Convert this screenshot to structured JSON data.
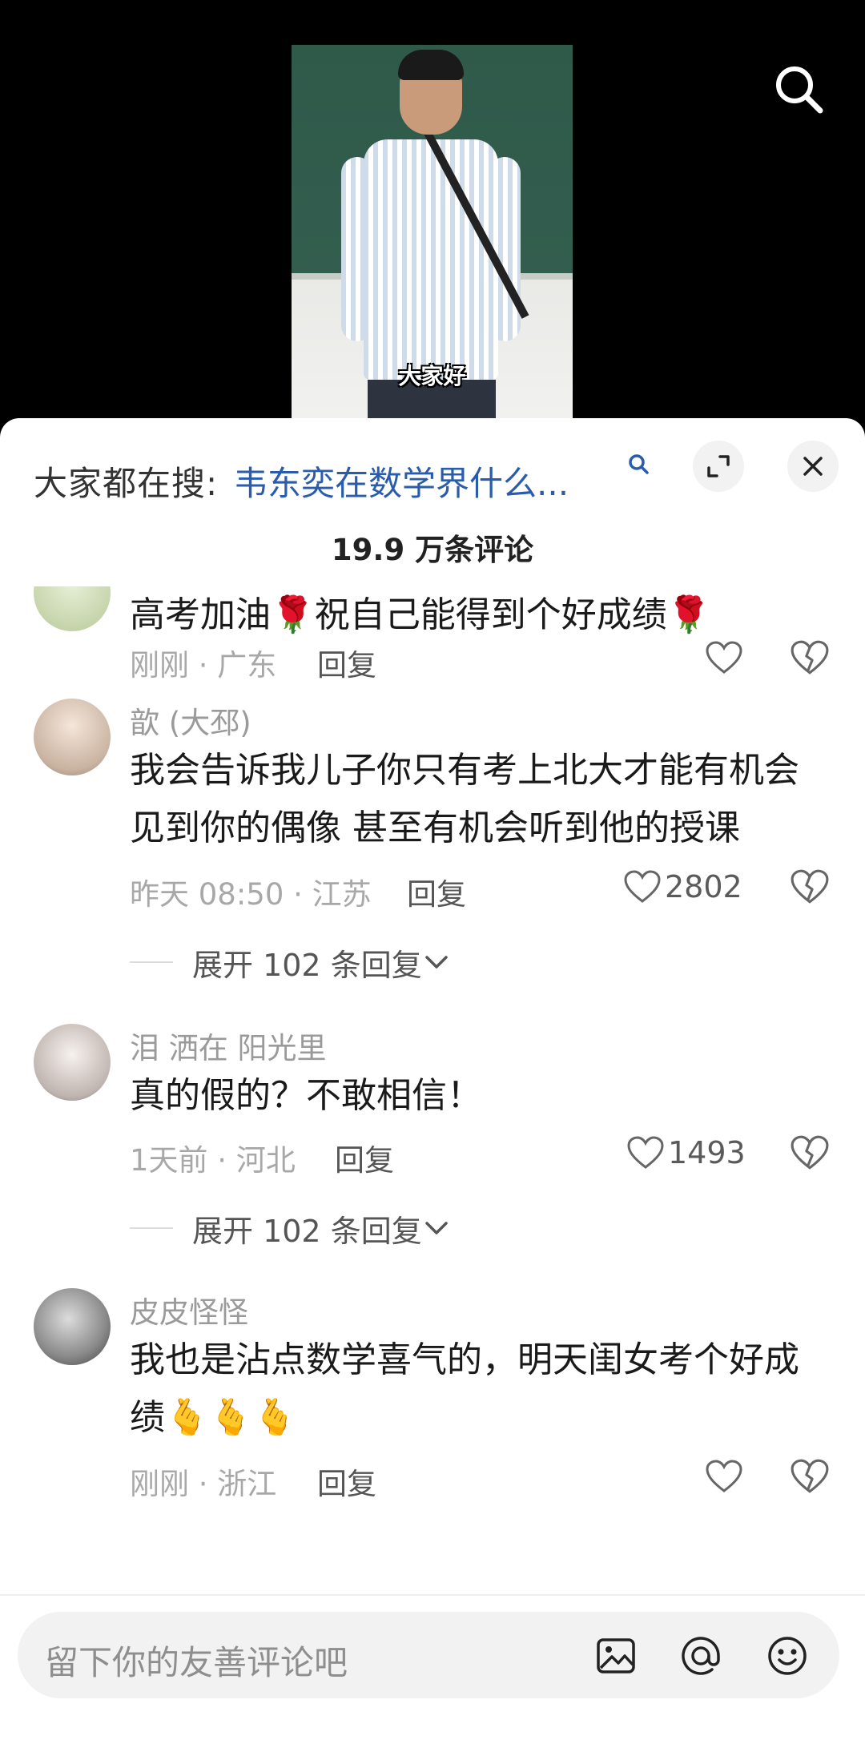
{
  "video": {
    "caption": "大家好"
  },
  "header": {
    "search_prefix": "大家都在搜:",
    "search_link": "韦东奕在数学界什么...",
    "count_title": "19.9 万条评论"
  },
  "comments": [
    {
      "username": "",
      "text": "高考加油🌹祝自己能得到个好成绩🌹",
      "meta": "刚刚 · 广东",
      "reply": "回复",
      "likes": ""
    },
    {
      "username": "歆 (大邳)",
      "text": "我会告诉我儿子你只有考上北大才能有机会见到你的偶像 甚至有机会听到他的授课",
      "meta": "昨天 08:50 · 江苏",
      "reply": "回复",
      "likes": "2802",
      "expand": "展开 102 条回复"
    },
    {
      "username": "泪 洒在 阳光里",
      "text": "真的假的？不敢相信！",
      "meta": "1天前 · 河北",
      "reply": "回复",
      "likes": "1493",
      "expand": "展开 102 条回复"
    },
    {
      "username": "皮皮怪怪",
      "text": "我也是沾点数学喜气的，明天闺女考个好成绩🫰🫰🫰",
      "meta": "刚刚 · 浙江",
      "reply": "回复",
      "likes": ""
    }
  ],
  "input": {
    "placeholder": "留下你的友善评论吧"
  },
  "icons": {
    "top": "search-icon",
    "header": [
      "mini-search-icon",
      "expand-icon",
      "close-icon"
    ],
    "row": [
      "heart-icon",
      "dislike-heart-icon",
      "chevron-down-icon"
    ],
    "input": [
      "image-icon",
      "at-icon",
      "emoji-icon"
    ]
  }
}
